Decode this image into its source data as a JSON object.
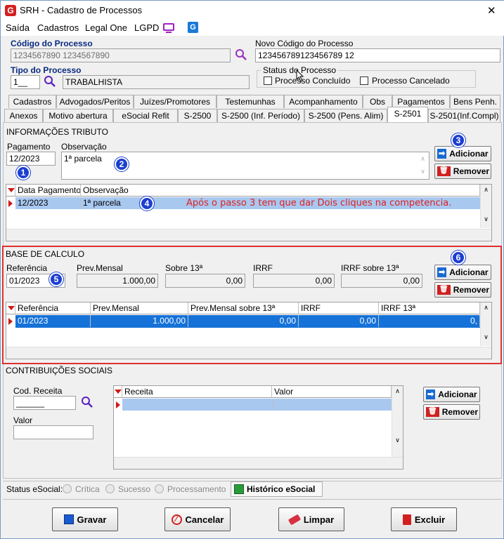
{
  "window": {
    "title": "SRH - Cadastro de Processos",
    "close": "✕"
  },
  "menu": [
    "Saída",
    "Cadastros",
    "Legal One",
    "LGPD"
  ],
  "codigo": {
    "label": "Código do Processo",
    "value": "1234567890 1234567890"
  },
  "novo_codigo": {
    "label": "Novo Código do Processo",
    "value": "123456789123456789 12"
  },
  "tipo": {
    "label": "Tipo do Processo",
    "code": "1__",
    "name": "TRABALHISTA"
  },
  "status": {
    "label": "Status do Processo",
    "concluido": "Processo Concluído",
    "cancelado": "Processo Cancelado"
  },
  "tabs_row1": [
    "Cadastros",
    "Advogados/Peritos",
    "Juízes/Promotores",
    "Testemunhas",
    "Acompanhamento",
    "Obs",
    "Pagamentos",
    "Bens Penh."
  ],
  "tabs_row2": [
    "Anexos",
    "Motivo abertura",
    "eSocial Refit",
    "S-2500",
    "S-2500 (Inf. Período)",
    "S-2500 (Pens. Alim)",
    "S-2501",
    "S-2501(Inf.Compl)"
  ],
  "info": {
    "section": "INFORMAÇÕES TRIBUTO",
    "pagamento_label": "Pagamento",
    "pagamento_value": "12/2023",
    "observacao_label": "Observação",
    "observacao_value": "1ª parcela",
    "add": "Adicionar",
    "remove": "Remover",
    "columns": [
      "Data Pagamento",
      "Observação"
    ],
    "row": [
      "12/2023",
      "1ª parcela"
    ],
    "note": "Após o passo 3 tem que dar Dois cliques na competencia."
  },
  "base": {
    "section": "BASE DE CALCULO",
    "ref_label": "Referência",
    "ref_value": "01/2023",
    "prev_label": "Prev.Mensal",
    "prev_value": "1.000,00",
    "sobre_label": "Sobre 13ª",
    "sobre_value": "0,00",
    "irrf_label": "IRRF",
    "irrf_value": "0,00",
    "irrf13_label": "IRRF sobre  13ª",
    "irrf13_value": "0,00",
    "add": "Adicionar",
    "remove": "Remover",
    "columns": [
      "Referência",
      "Prev.Mensal",
      "Prev.Mensal sobre 13ª",
      "IRRF",
      "IRRF 13ª"
    ],
    "row": [
      "01/2023",
      "1.000,00",
      "0,00",
      "0,00",
      "0,"
    ]
  },
  "contrib": {
    "section": "CONTRIBUIÇÕES SOCIAIS",
    "cod_label": "Cod. Receita",
    "cod_value": "______",
    "valor_label": "Valor",
    "columns": [
      "Receita",
      "Valor"
    ],
    "add": "Adicionar",
    "remove": "Remover"
  },
  "esocial": {
    "label": "Status eSocial:",
    "critica": "Crítica",
    "sucesso": "Sucesso",
    "processamento": "Processamento",
    "historico": "Histórico eSocial"
  },
  "footer": {
    "gravar": "Gravar",
    "cancelar": "Cancelar",
    "limpar": "Limpar",
    "excluir": "Excluir"
  },
  "badges": [
    "1",
    "2",
    "3",
    "4",
    "5",
    "6"
  ],
  "colors": {
    "selection": "#1572d8",
    "badge": "#1c3fd1",
    "highlight_border": "#e03030",
    "note": "#e02020"
  }
}
